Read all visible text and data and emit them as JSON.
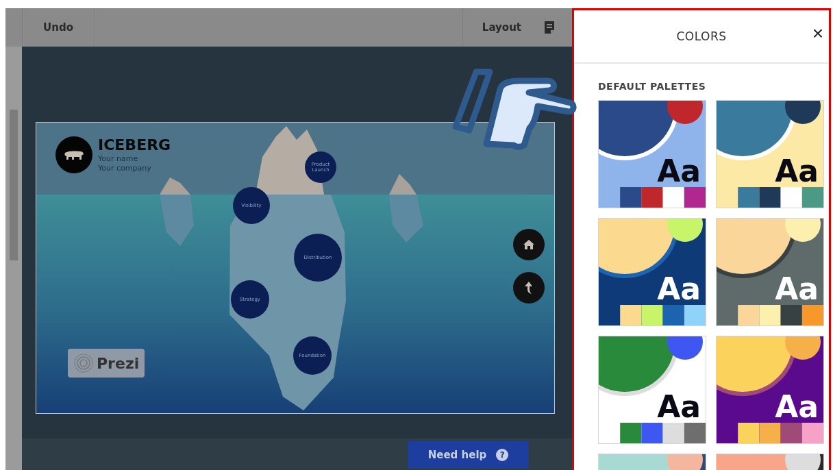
{
  "toolbar": {
    "undo": "Undo",
    "layout": "Layout"
  },
  "slide": {
    "title": "ICEBERG",
    "subtitle_lines": [
      "Your name",
      "Your company"
    ],
    "topics": [
      {
        "label": "Product Launch"
      },
      {
        "label": "Visibility"
      },
      {
        "label": "Distribution"
      },
      {
        "label": "Strategy"
      },
      {
        "label": "Foundation"
      }
    ],
    "badge": "Prezi"
  },
  "help_button": {
    "label": "Need help",
    "icon": "?"
  },
  "panel": {
    "title": "COLORS",
    "close": "×",
    "section": "DEFAULT PALETTES",
    "palettes": [
      {
        "sample": "Aa",
        "light_text": false,
        "swatches": [
          {
            "color": "#8fb4ec"
          },
          {
            "color": "#2a4a8a"
          },
          {
            "color": "#c0272d"
          },
          {
            "color": "#ffffff"
          },
          {
            "color": "#b0278f"
          }
        ]
      },
      {
        "sample": "Aa",
        "light_text": false,
        "swatches": [
          {
            "color": "#fde9a6"
          },
          {
            "color": "#3a7a9c"
          },
          {
            "color": "#1f3a58"
          },
          {
            "color": "#ffffff"
          },
          {
            "color": "#4a9a85"
          }
        ]
      },
      {
        "sample": "Aa",
        "light_text": true,
        "swatches": [
          {
            "color": "#0e3a78"
          },
          {
            "color": "#fbd98f"
          },
          {
            "color": "#c8f46a"
          },
          {
            "color": "#1c64b0"
          },
          {
            "color": "#8fd2fa"
          }
        ]
      },
      {
        "sample": "Aa",
        "light_text": true,
        "swatches": [
          {
            "color": "#5f6b6a"
          },
          {
            "color": "#fad69a"
          },
          {
            "color": "#fdf0ae"
          },
          {
            "color": "#384142"
          },
          {
            "color": "#f8972a"
          }
        ]
      },
      {
        "sample": "Aa",
        "light_text": false,
        "swatches": [
          {
            "color": "#ffffff"
          },
          {
            "color": "#2a8a3c"
          },
          {
            "color": "#3e56f2"
          },
          {
            "color": "#dddddd"
          },
          {
            "color": "#6e6e6e"
          }
        ]
      },
      {
        "sample": "Aa",
        "light_text": true,
        "swatches": [
          {
            "color": "#5a0a8c"
          },
          {
            "color": "#fbd25c"
          },
          {
            "color": "#f6b04a"
          },
          {
            "color": "#a04a78"
          },
          {
            "color": "#f7a0c8"
          }
        ]
      },
      {
        "swatches": [
          {
            "color": "#2e4a7a"
          },
          {
            "color": "#a8dad4"
          },
          {
            "color": "#f5b6a0"
          }
        ]
      },
      {
        "swatches": [
          {
            "color": "#2a2a2a"
          },
          {
            "color": "#f9a58a"
          },
          {
            "color": "#dddddd"
          }
        ]
      }
    ]
  }
}
